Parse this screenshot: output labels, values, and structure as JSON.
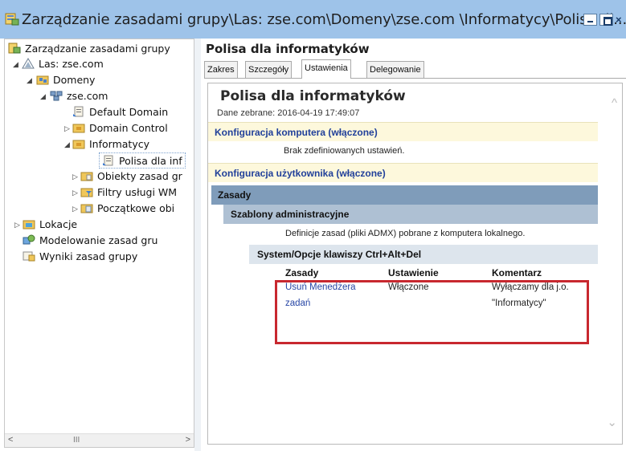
{
  "window": {
    "title": "Zarządzanie zasadami grupy\\Las: zse.com\\Domeny\\zse.com \\Informatycy\\Polisa dl...",
    "close_glyph": "×"
  },
  "tree": {
    "items": [
      {
        "label": "Zarządzanie zasadami grupy",
        "icon": "gpm-console-icon"
      },
      {
        "label": "Las: zse.com",
        "icon": "forest-icon"
      },
      {
        "label": "Domeny",
        "icon": "domains-folder-icon"
      },
      {
        "label": "zse.com",
        "icon": "domain-icon"
      },
      {
        "label": "Default Domain",
        "icon": "gpo-link-icon"
      },
      {
        "label": "Domain Control",
        "icon": "ou-folder-icon"
      },
      {
        "label": "Informatycy",
        "icon": "ou-folder-icon"
      },
      {
        "label": "Polisa dla inf",
        "icon": "gpo-link-icon"
      },
      {
        "label": "Obiekty zasad gr",
        "icon": "gpo-folder-icon"
      },
      {
        "label": "Filtry usługi WM",
        "icon": "wmi-filter-folder-icon"
      },
      {
        "label": "Początkowe obi",
        "icon": "starter-gpo-folder-icon"
      },
      {
        "label": "Lokacje",
        "icon": "sites-icon"
      },
      {
        "label": "Modelowanie zasad gru",
        "icon": "modeling-icon"
      },
      {
        "label": "Wyniki zasad grupy",
        "icon": "results-icon"
      }
    ],
    "scroll_left": "<",
    "scroll_right": ">",
    "scroll_grip": "III"
  },
  "right": {
    "title": "Polisa dla informatyków",
    "tabs": [
      "Zakres",
      "Szczegóły",
      "Ustawienia",
      "Delegowanie"
    ],
    "active_tab": "Ustawienia"
  },
  "report": {
    "title": "Polisa dla informatyków",
    "date": "Dane zebrane: 2016-04-19 17:49:07",
    "computer_header": "Konfiguracja komputera (włączone)",
    "computer_note": "Brak zdefiniowanych ustawień.",
    "user_header": "Konfiguracja użytkownika (włączone)",
    "policies": "Zasady",
    "admin_templates": "Szablony administracyjne",
    "admx_note": "Definicje zasad (pliki ADMX) pobrane z komputera lokalnego.",
    "category": "System/Opcje klawiszy Ctrl+Alt+Del",
    "table": {
      "headers": [
        "Zasady",
        "Ustawienie",
        "Komentarz"
      ],
      "rows": [
        {
          "policy": "Usuń Menedżera zadań",
          "setting": "Włączone",
          "comment": "Wyłączamy dla j.o. \"Informatycy\""
        }
      ]
    },
    "scroll_up_glyph": "^",
    "scroll_down_glyph": "⌄"
  },
  "colors": {
    "highlight_box": "#c8282f",
    "link": "#2746a5",
    "yellow_band": "#fdf8dc"
  }
}
